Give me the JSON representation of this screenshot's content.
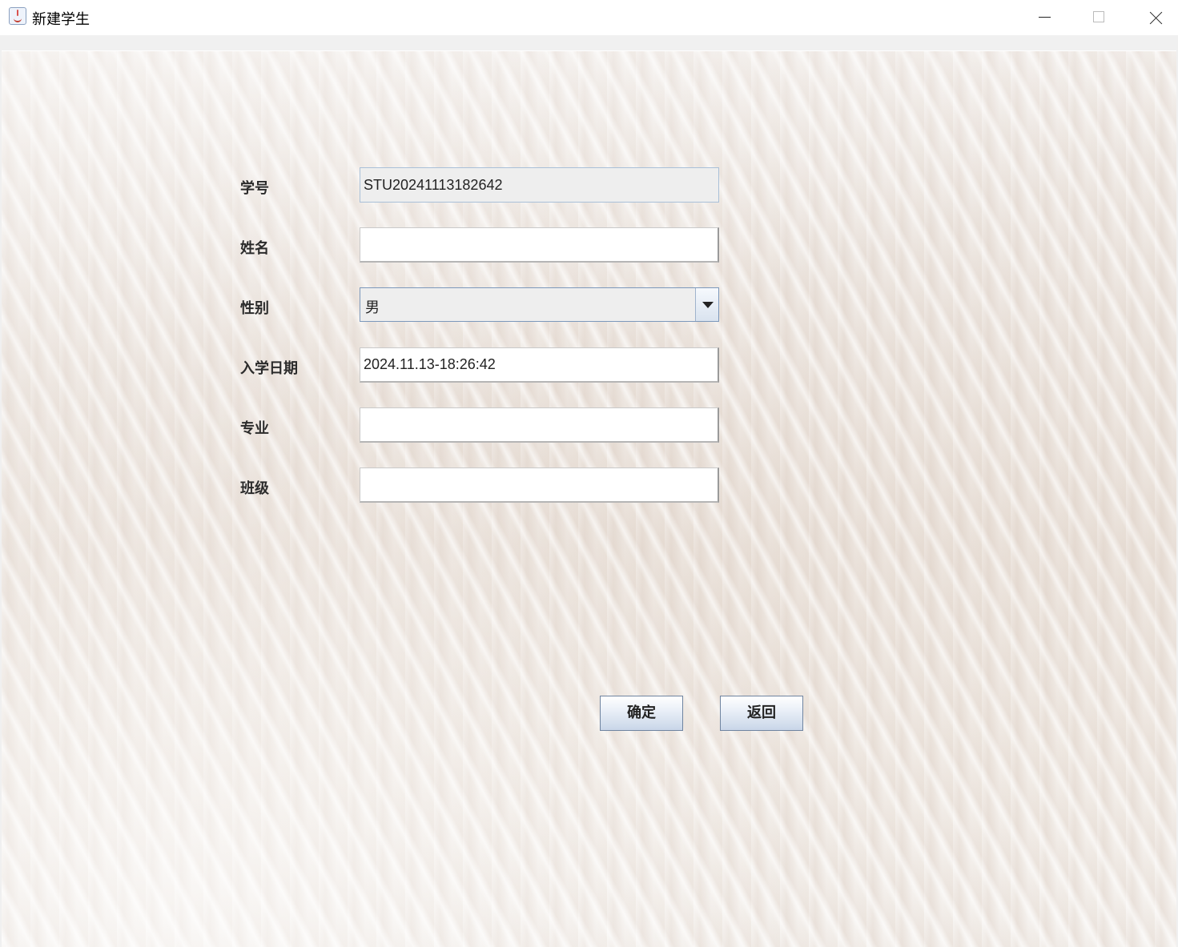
{
  "window": {
    "title": "新建学生",
    "icon": "java-cup-icon"
  },
  "form": {
    "student_id": {
      "label": "学号",
      "value": "STU20241113182642"
    },
    "name": {
      "label": "姓名",
      "value": ""
    },
    "gender": {
      "label": "性别",
      "selected": "男"
    },
    "enroll_date": {
      "label": "入学日期",
      "value": "2024.11.13-18:26:42"
    },
    "major": {
      "label": "专业",
      "value": ""
    },
    "class": {
      "label": "班级",
      "value": ""
    }
  },
  "buttons": {
    "confirm": "确定",
    "back": "返回"
  }
}
